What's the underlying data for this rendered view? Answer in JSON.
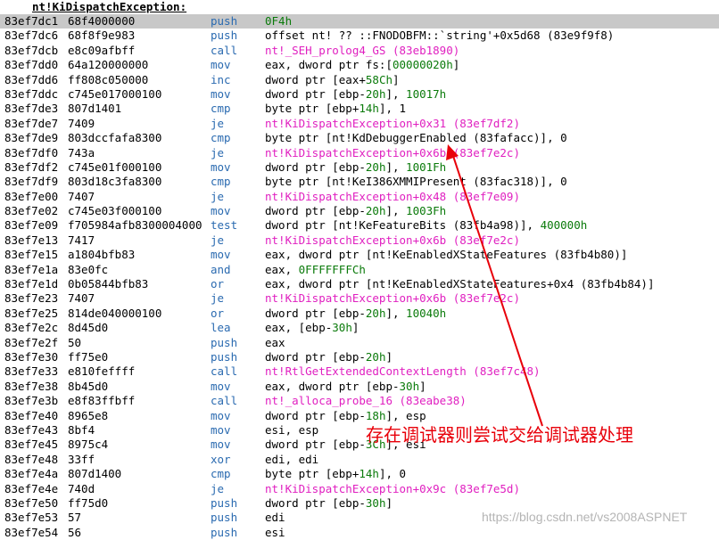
{
  "title": "nt!KiDispatchException:",
  "annotation": "存在调试器则尝试交给调试器处理",
  "watermark": "https://blog.csdn.net/vs2008ASPNET",
  "colors": {
    "mnemonic": "#2a6ab0",
    "number": "#0a7a0a",
    "symbol": "#e020c0",
    "highlight_row": "#c8c8c8",
    "annotation": "#e8000a"
  },
  "rows": [
    {
      "addr": "83ef7dc1",
      "bytes": "68f4000000",
      "mnemonic": "push",
      "operand": [
        [
          "0F4h",
          "num"
        ]
      ],
      "highlight": true
    },
    {
      "addr": "83ef7dc6",
      "bytes": "68f8f9e983",
      "mnemonic": "push",
      "operand": [
        [
          "offset nt! ?? ::FNODOBFM::`string'+0x5d68 (83e9f9f8)",
          "plain"
        ]
      ]
    },
    {
      "addr": "83ef7dcb",
      "bytes": "e8c09afbff",
      "mnemonic": "call",
      "operand": [
        [
          "nt!_SEH_prolog4_GS (83eb1890)",
          "sym"
        ]
      ]
    },
    {
      "addr": "83ef7dd0",
      "bytes": "64a120000000",
      "mnemonic": "mov",
      "operand": [
        [
          "eax, dword ptr fs:[",
          "plain"
        ],
        [
          "00000020h",
          "num"
        ],
        [
          "]",
          "plain"
        ]
      ]
    },
    {
      "addr": "83ef7dd6",
      "bytes": "ff808c050000",
      "mnemonic": "inc",
      "operand": [
        [
          "dword ptr [eax+",
          "plain"
        ],
        [
          "58Ch",
          "num"
        ],
        [
          "]",
          "plain"
        ]
      ]
    },
    {
      "addr": "83ef7ddc",
      "bytes": "c745e017000100",
      "mnemonic": "mov",
      "operand": [
        [
          "dword ptr [ebp-",
          "plain"
        ],
        [
          "20h",
          "num"
        ],
        [
          "], ",
          "plain"
        ],
        [
          "10017h",
          "num"
        ]
      ]
    },
    {
      "addr": "83ef7de3",
      "bytes": "807d1401",
      "mnemonic": "cmp",
      "operand": [
        [
          "byte ptr [ebp+",
          "plain"
        ],
        [
          "14h",
          "num"
        ],
        [
          "], 1",
          "plain"
        ]
      ]
    },
    {
      "addr": "83ef7de7",
      "bytes": "7409",
      "mnemonic": "je",
      "operand": [
        [
          "nt!KiDispatchException+0x31 (83ef7df2)",
          "sym"
        ]
      ]
    },
    {
      "addr": "83ef7de9",
      "bytes": "803dccfafa8300",
      "mnemonic": "cmp",
      "operand": [
        [
          "byte ptr [nt!KdDebuggerEnabled (83fafacc)], 0",
          "plain"
        ]
      ]
    },
    {
      "addr": "83ef7df0",
      "bytes": "743a",
      "mnemonic": "je",
      "operand": [
        [
          "nt!KiDispatchException+0x6b (83ef7e2c)",
          "sym"
        ]
      ]
    },
    {
      "addr": "83ef7df2",
      "bytes": "c745e01f000100",
      "mnemonic": "mov",
      "operand": [
        [
          "dword ptr [ebp-",
          "plain"
        ],
        [
          "20h",
          "num"
        ],
        [
          "], ",
          "plain"
        ],
        [
          "1001Fh",
          "num"
        ]
      ]
    },
    {
      "addr": "83ef7df9",
      "bytes": "803d18c3fa8300",
      "mnemonic": "cmp",
      "operand": [
        [
          "byte ptr [nt!KeI386XMMIPresent (83fac318)], 0",
          "plain"
        ]
      ]
    },
    {
      "addr": "83ef7e00",
      "bytes": "7407",
      "mnemonic": "je",
      "operand": [
        [
          "nt!KiDispatchException+0x48 (83ef7e09)",
          "sym"
        ]
      ]
    },
    {
      "addr": "83ef7e02",
      "bytes": "c745e03f000100",
      "mnemonic": "mov",
      "operand": [
        [
          "dword ptr [ebp-",
          "plain"
        ],
        [
          "20h",
          "num"
        ],
        [
          "], ",
          "plain"
        ],
        [
          "1003Fh",
          "num"
        ]
      ]
    },
    {
      "addr": "83ef7e09",
      "bytes": "f705984afb8300004000",
      "mnemonic": "test",
      "operand": [
        [
          "dword ptr [nt!KeFeatureBits (83fb4a98)], ",
          "plain"
        ],
        [
          "400000h",
          "num"
        ]
      ]
    },
    {
      "addr": "83ef7e13",
      "bytes": "7417",
      "mnemonic": "je",
      "operand": [
        [
          "nt!KiDispatchException+0x6b (83ef7e2c)",
          "sym"
        ]
      ]
    },
    {
      "addr": "83ef7e15",
      "bytes": "a1804bfb83",
      "mnemonic": "mov",
      "operand": [
        [
          "eax, dword ptr [nt!KeEnabledXStateFeatures (83fb4b80)]",
          "plain"
        ]
      ]
    },
    {
      "addr": "83ef7e1a",
      "bytes": "83e0fc",
      "mnemonic": "and",
      "operand": [
        [
          "eax, ",
          "plain"
        ],
        [
          "0FFFFFFFCh",
          "num"
        ]
      ]
    },
    {
      "addr": "83ef7e1d",
      "bytes": "0b05844bfb83",
      "mnemonic": "or",
      "operand": [
        [
          "eax, dword ptr [nt!KeEnabledXStateFeatures+0x4 (83fb4b84)]",
          "plain"
        ]
      ]
    },
    {
      "addr": "83ef7e23",
      "bytes": "7407",
      "mnemonic": "je",
      "operand": [
        [
          "nt!KiDispatchException+0x6b (83ef7e2c)",
          "sym"
        ]
      ]
    },
    {
      "addr": "83ef7e25",
      "bytes": "814de040000100",
      "mnemonic": "or",
      "operand": [
        [
          "dword ptr [ebp-",
          "plain"
        ],
        [
          "20h",
          "num"
        ],
        [
          "], ",
          "plain"
        ],
        [
          "10040h",
          "num"
        ]
      ]
    },
    {
      "addr": "83ef7e2c",
      "bytes": "8d45d0",
      "mnemonic": "lea",
      "operand": [
        [
          "eax, [ebp-",
          "plain"
        ],
        [
          "30h",
          "num"
        ],
        [
          "]",
          "plain"
        ]
      ]
    },
    {
      "addr": "83ef7e2f",
      "bytes": "50",
      "mnemonic": "push",
      "operand": [
        [
          "eax",
          "plain"
        ]
      ]
    },
    {
      "addr": "83ef7e30",
      "bytes": "ff75e0",
      "mnemonic": "push",
      "operand": [
        [
          "dword ptr [ebp-",
          "plain"
        ],
        [
          "20h",
          "num"
        ],
        [
          "]",
          "plain"
        ]
      ]
    },
    {
      "addr": "83ef7e33",
      "bytes": "e810feffff",
      "mnemonic": "call",
      "operand": [
        [
          "nt!RtlGetExtendedContextLength (83ef7c48)",
          "sym"
        ]
      ]
    },
    {
      "addr": "83ef7e38",
      "bytes": "8b45d0",
      "mnemonic": "mov",
      "operand": [
        [
          "eax, dword ptr [ebp-",
          "plain"
        ],
        [
          "30h",
          "num"
        ],
        [
          "]",
          "plain"
        ]
      ]
    },
    {
      "addr": "83ef7e3b",
      "bytes": "e8f83ffbff",
      "mnemonic": "call",
      "operand": [
        [
          "nt!_alloca_probe_16 (83eabe38)",
          "sym"
        ]
      ]
    },
    {
      "addr": "83ef7e40",
      "bytes": "8965e8",
      "mnemonic": "mov",
      "operand": [
        [
          "dword ptr [ebp-",
          "plain"
        ],
        [
          "18h",
          "num"
        ],
        [
          "], esp",
          "plain"
        ]
      ]
    },
    {
      "addr": "83ef7e43",
      "bytes": "8bf4",
      "mnemonic": "mov",
      "operand": [
        [
          "esi, esp",
          "plain"
        ]
      ]
    },
    {
      "addr": "83ef7e45",
      "bytes": "8975c4",
      "mnemonic": "mov",
      "operand": [
        [
          "dword ptr [ebp-",
          "plain"
        ],
        [
          "3Ch",
          "num"
        ],
        [
          "], esi",
          "plain"
        ]
      ]
    },
    {
      "addr": "83ef7e48",
      "bytes": "33ff",
      "mnemonic": "xor",
      "operand": [
        [
          "edi, edi",
          "plain"
        ]
      ]
    },
    {
      "addr": "83ef7e4a",
      "bytes": "807d1400",
      "mnemonic": "cmp",
      "operand": [
        [
          "byte ptr [ebp+",
          "plain"
        ],
        [
          "14h",
          "num"
        ],
        [
          "], 0",
          "plain"
        ]
      ]
    },
    {
      "addr": "83ef7e4e",
      "bytes": "740d",
      "mnemonic": "je",
      "operand": [
        [
          "nt!KiDispatchException+0x9c (83ef7e5d)",
          "sym"
        ]
      ]
    },
    {
      "addr": "83ef7e50",
      "bytes": "ff75d0",
      "mnemonic": "push",
      "operand": [
        [
          "dword ptr [ebp-",
          "plain"
        ],
        [
          "30h",
          "num"
        ],
        [
          "]",
          "plain"
        ]
      ]
    },
    {
      "addr": "83ef7e53",
      "bytes": "57",
      "mnemonic": "push",
      "operand": [
        [
          "edi",
          "plain"
        ]
      ]
    },
    {
      "addr": "83ef7e54",
      "bytes": "56",
      "mnemonic": "push",
      "operand": [
        [
          "esi",
          "plain"
        ]
      ]
    }
  ]
}
